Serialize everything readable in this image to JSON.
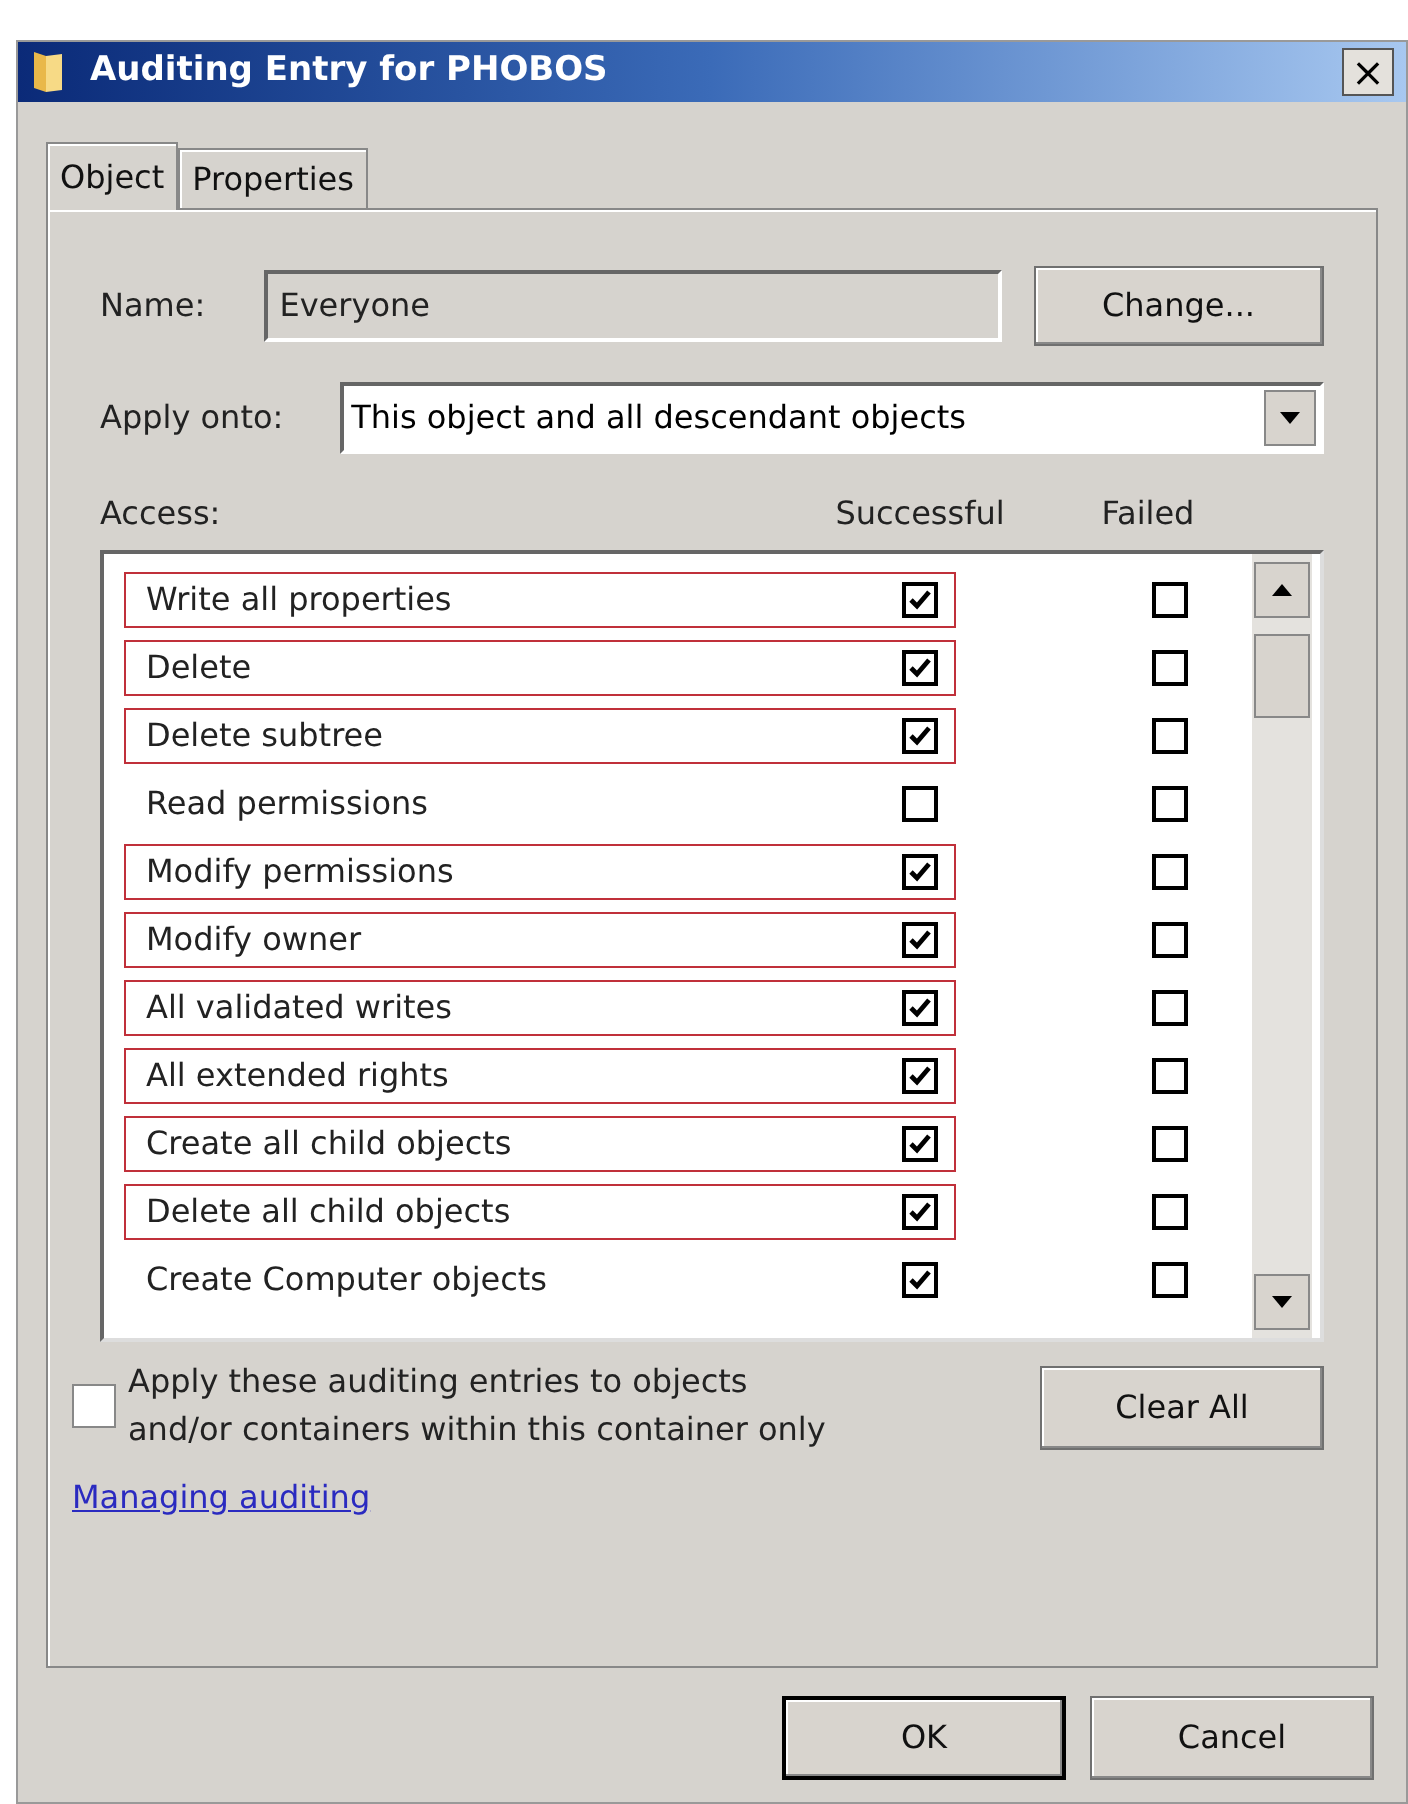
{
  "window": {
    "title": "Auditing Entry for PHOBOS",
    "close": "×"
  },
  "tabs": [
    {
      "label": "Object",
      "selected": true
    },
    {
      "label": "Properties",
      "selected": false
    }
  ],
  "name": {
    "label": "Name:",
    "value": "Everyone",
    "button": "Change..."
  },
  "apply_onto": {
    "label": "Apply onto:",
    "value": "This object and all descendant objects"
  },
  "access": {
    "label": "Access:",
    "columns": [
      "Successful",
      "Failed"
    ],
    "rows": [
      {
        "name": "Write all properties",
        "successful": true,
        "failed": false,
        "highlighted": true
      },
      {
        "name": "Delete",
        "successful": true,
        "failed": false,
        "highlighted": true
      },
      {
        "name": "Delete subtree",
        "successful": true,
        "failed": false,
        "highlighted": true
      },
      {
        "name": "Read permissions",
        "successful": false,
        "failed": false,
        "highlighted": false
      },
      {
        "name": "Modify permissions",
        "successful": true,
        "failed": false,
        "highlighted": true
      },
      {
        "name": "Modify owner",
        "successful": true,
        "failed": false,
        "highlighted": true
      },
      {
        "name": "All validated writes",
        "successful": true,
        "failed": false,
        "highlighted": true
      },
      {
        "name": "All extended rights",
        "successful": true,
        "failed": false,
        "highlighted": true
      },
      {
        "name": "Create all child objects",
        "successful": true,
        "failed": false,
        "highlighted": true
      },
      {
        "name": "Delete all child objects",
        "successful": true,
        "failed": false,
        "highlighted": true
      },
      {
        "name": "Create Computer objects",
        "successful": true,
        "failed": false,
        "highlighted": false
      }
    ]
  },
  "apply_within": {
    "label": "Apply these auditing entries to objects and/or containers within this container only",
    "checked": false
  },
  "clear_all": "Clear All",
  "link": "Managing auditing",
  "buttons": [
    "OK",
    "Cancel"
  ]
}
